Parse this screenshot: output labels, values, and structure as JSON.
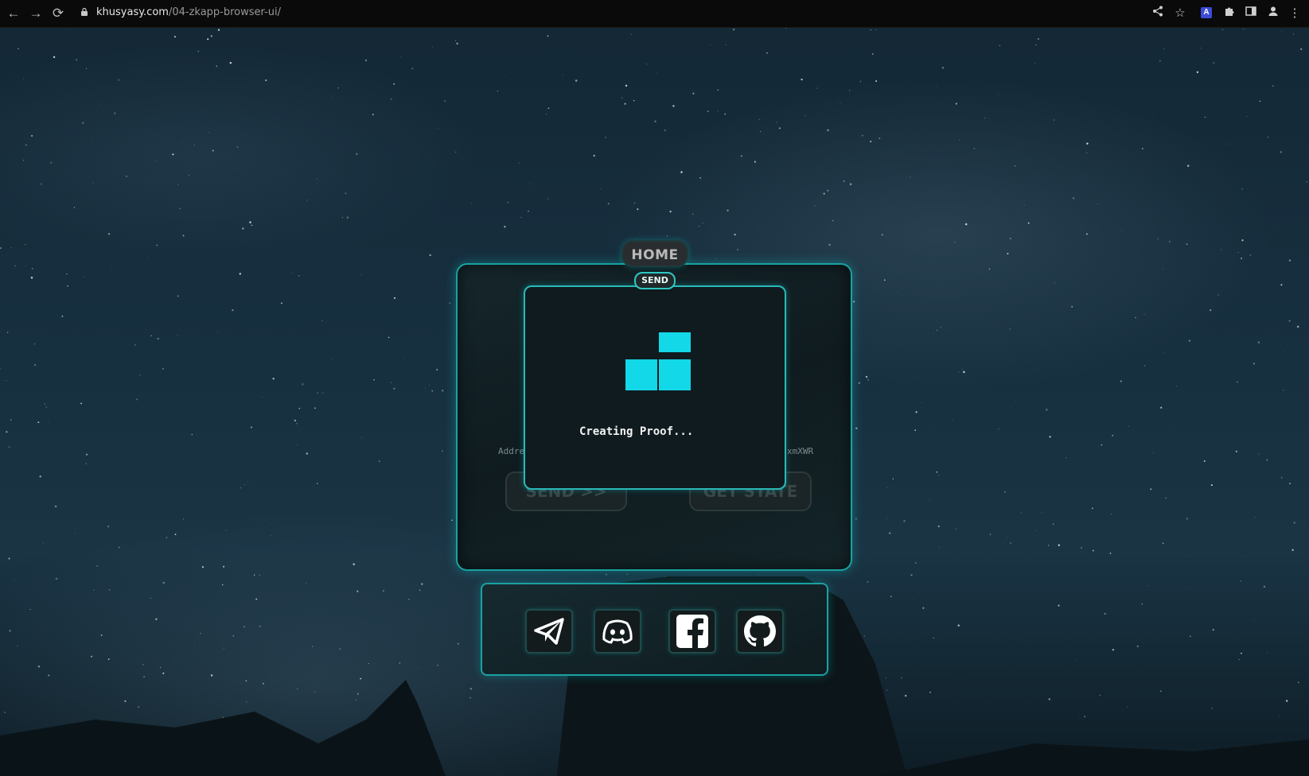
{
  "browser": {
    "url_domain": "khusyasy.com",
    "url_path": "/04-zkapp-browser-ui/",
    "nav": {
      "back": "←",
      "forward": "→",
      "reload": "⟳"
    }
  },
  "app": {
    "home_tab": "HOME",
    "send_tab": "SEND",
    "address_label_partial": "Addre",
    "address_value_partial": "xmXWR",
    "send_button": "SEND >>",
    "get_state_button": "GET STATE"
  },
  "modal": {
    "status_text": "Creating Proof..."
  },
  "social": [
    {
      "icon": "telegram-icon"
    },
    {
      "icon": "discord-icon"
    },
    {
      "icon": "facebook-icon"
    },
    {
      "icon": "github-icon"
    }
  ],
  "colors": {
    "accent": "#13d8e8",
    "panel_border": "#1aa1a1",
    "topbar": "#0a0a0a"
  }
}
